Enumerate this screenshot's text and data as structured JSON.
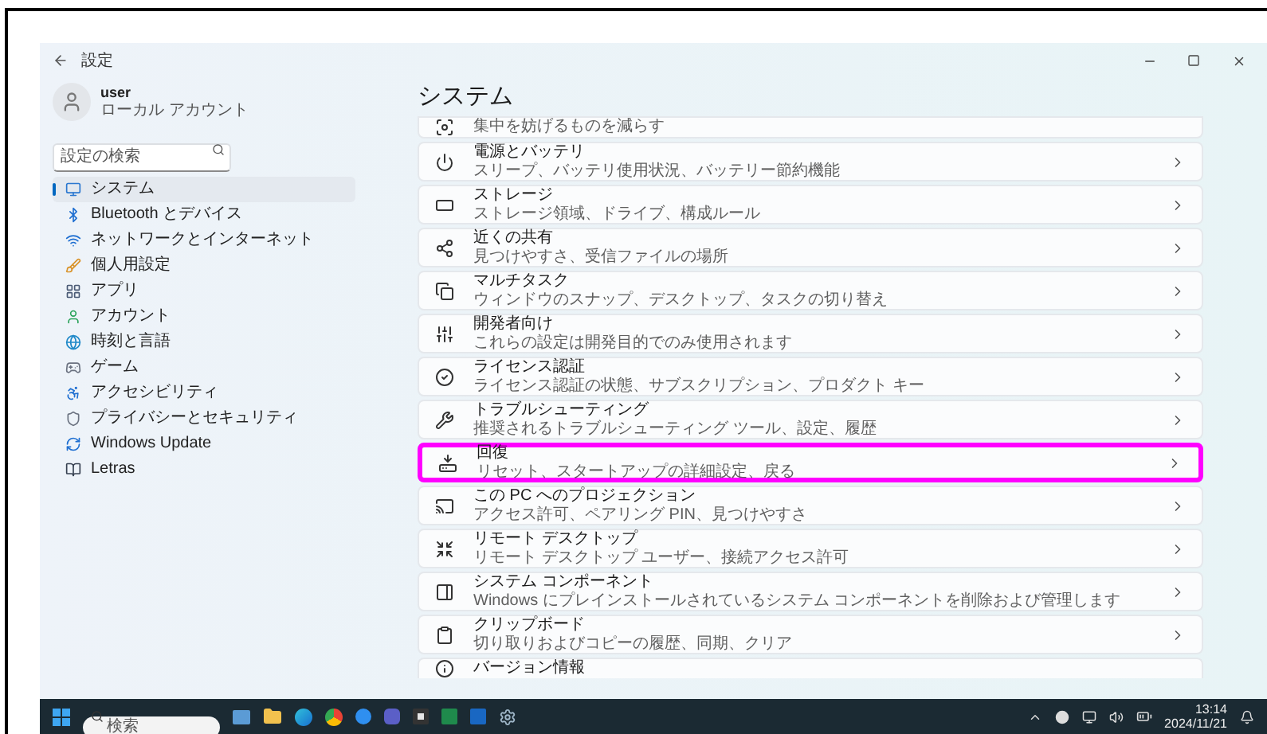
{
  "window": {
    "title": "設定"
  },
  "account": {
    "name": "user",
    "type": "ローカル アカウント"
  },
  "search": {
    "placeholder": "設定の検索"
  },
  "sidebar": {
    "items": [
      {
        "label": "システム",
        "selected": true
      },
      {
        "label": "Bluetooth とデバイス",
        "selected": false
      },
      {
        "label": "ネットワークとインターネット",
        "selected": false
      },
      {
        "label": "個人用設定",
        "selected": false
      },
      {
        "label": "アプリ",
        "selected": false
      },
      {
        "label": "アカウント",
        "selected": false
      },
      {
        "label": "時刻と言語",
        "selected": false
      },
      {
        "label": "ゲーム",
        "selected": false
      },
      {
        "label": "アクセシビリティ",
        "selected": false
      },
      {
        "label": "プライバシーとセキュリティ",
        "selected": false
      },
      {
        "label": "Windows Update",
        "selected": false
      },
      {
        "label": "Letras",
        "selected": false
      }
    ]
  },
  "page": {
    "title": "システム",
    "cards": [
      {
        "kind": "top_cut",
        "description": "集中を妨げるものを減らす",
        "highlighted": false
      },
      {
        "kind": "full",
        "title": "電源とバッテリ",
        "description": "スリープ、バッテリ使用状況、バッテリー節約機能",
        "highlighted": false
      },
      {
        "kind": "full",
        "title": "ストレージ",
        "description": "ストレージ領域、ドライブ、構成ルール",
        "highlighted": false
      },
      {
        "kind": "full",
        "title": "近くの共有",
        "description": "見つけやすさ、受信ファイルの場所",
        "highlighted": false
      },
      {
        "kind": "full",
        "title": "マルチタスク",
        "description": "ウィンドウのスナップ、デスクトップ、タスクの切り替え",
        "highlighted": false
      },
      {
        "kind": "full",
        "title": "開発者向け",
        "description": "これらの設定は開発目的でのみ使用されます",
        "highlighted": false
      },
      {
        "kind": "full",
        "title": "ライセンス認証",
        "description": "ライセンス認証の状態、サブスクリプション、プロダクト キー",
        "highlighted": false
      },
      {
        "kind": "full",
        "title": "トラブルシューティング",
        "description": "推奨されるトラブルシューティング ツール、設定、履歴",
        "highlighted": false
      },
      {
        "kind": "full",
        "title": "回復",
        "description": "リセット、スタートアップの詳細設定、戻る",
        "highlighted": true
      },
      {
        "kind": "full",
        "title": "この PC へのプロジェクション",
        "description": "アクセス許可、ペアリング PIN、見つけやすさ",
        "highlighted": false
      },
      {
        "kind": "full",
        "title": "リモート デスクトップ",
        "description": "リモート デスクトップ ユーザー、接続アクセス許可",
        "highlighted": false
      },
      {
        "kind": "full",
        "title": "システム コンポーネント",
        "description": "Windows にプレインストールされているシステム コンポーネントを削除および管理します",
        "highlighted": false
      },
      {
        "kind": "full",
        "title": "クリップボード",
        "description": "切り取りおよびコピーの履歴、同期、クリア",
        "highlighted": false
      },
      {
        "kind": "bottom_cut",
        "title": "バージョン情報",
        "highlighted": false
      }
    ]
  },
  "taskbar": {
    "search": {
      "placeholder": "検索"
    },
    "clock": {
      "time": "13:14",
      "date": "2024/11/21"
    }
  }
}
